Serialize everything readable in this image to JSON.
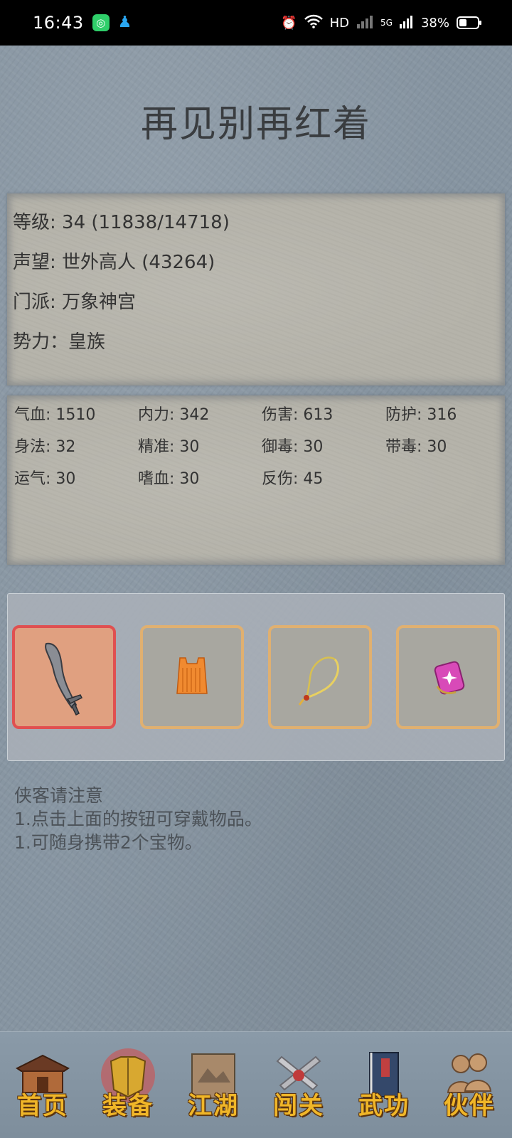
{
  "status": {
    "time": "16:43",
    "network": "HD",
    "signal": "5G",
    "battery": "38%"
  },
  "title": "再见别再红着",
  "info": {
    "level": "等级: 34 (11838/14718)",
    "reputation": "声望: 世外高人 (43264)",
    "sect": "门派: 万象神宫",
    "faction": "势力：皇族"
  },
  "stats": [
    "气血: 1510",
    "内力: 342",
    "伤害: 613",
    "防护: 316",
    "身法: 32",
    "精准: 30",
    "御毒: 30",
    "带毒: 30",
    "运气: 30",
    "嗜血: 30",
    "反伤: 45"
  ],
  "equipment": [
    {
      "icon": "sword-icon",
      "selected": true
    },
    {
      "icon": "robe-icon",
      "selected": false
    },
    {
      "icon": "necklace-icon",
      "selected": false
    },
    {
      "icon": "gem-icon",
      "selected": false
    }
  ],
  "notice": {
    "title": "侠客请注意",
    "line1": "1.点击上面的按钮可穿戴物品。",
    "line2": "1.可随身携带2个宝物。"
  },
  "nav": [
    {
      "label": "首页",
      "icon": "home-pavilion-icon"
    },
    {
      "label": "装备",
      "icon": "armor-icon"
    },
    {
      "label": "江湖",
      "icon": "scroll-map-icon"
    },
    {
      "label": "闯关",
      "icon": "crossed-swords-icon"
    },
    {
      "label": "武功",
      "icon": "book-icon"
    },
    {
      "label": "伙伴",
      "icon": "partners-icon"
    }
  ],
  "colors": {
    "background": "#8694a1",
    "gold": "#f0b628",
    "slot_border": "#e0b070",
    "slot_active": "#e05050"
  }
}
